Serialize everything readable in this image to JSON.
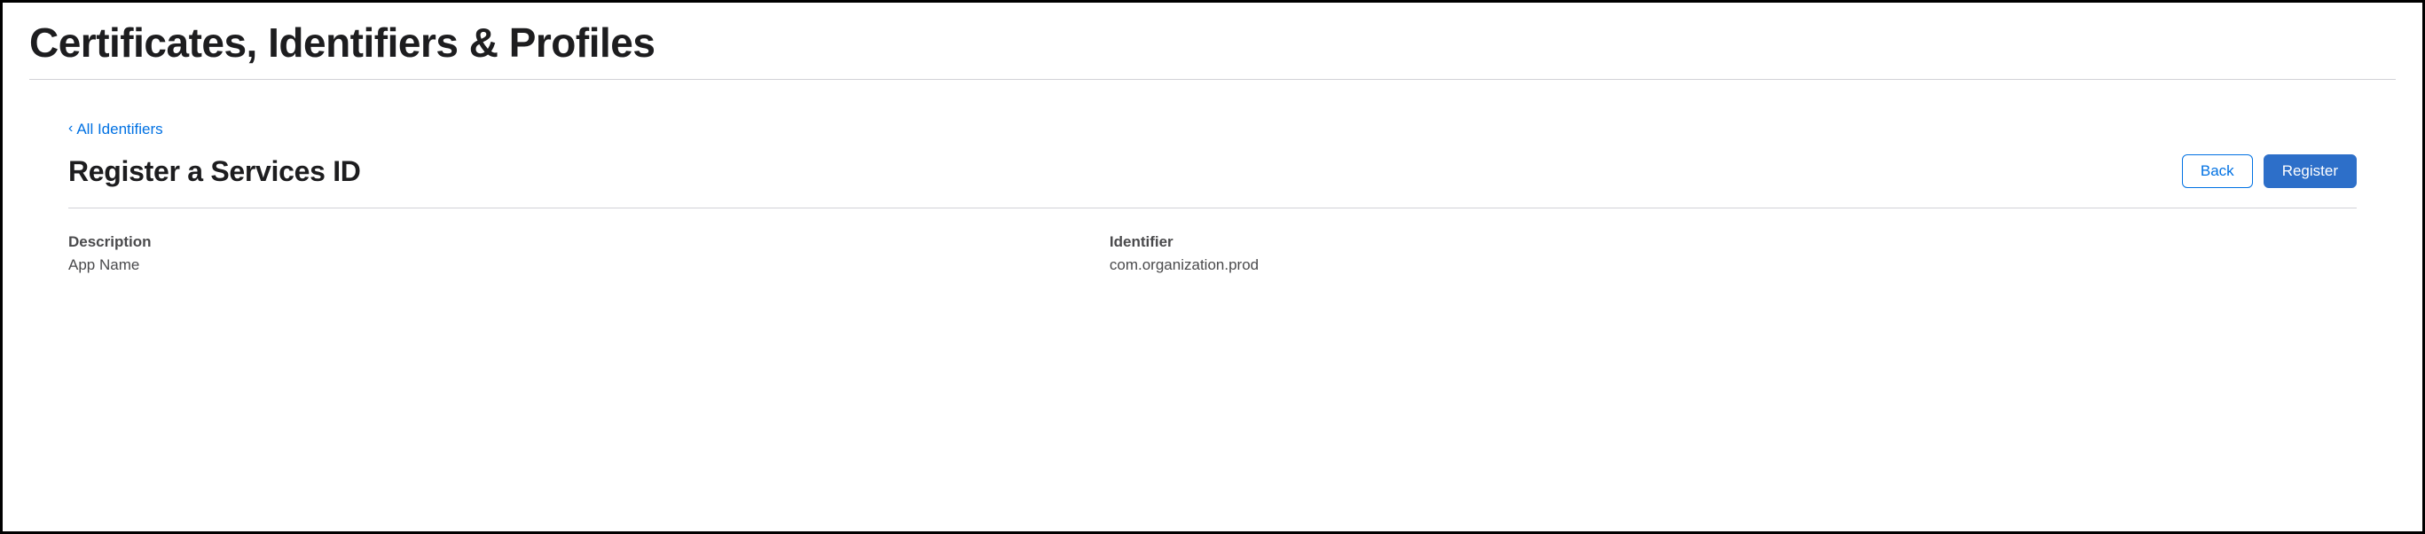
{
  "header": {
    "title": "Certificates, Identifiers & Profiles"
  },
  "nav": {
    "back_label": "All Identifiers"
  },
  "section": {
    "title": "Register a Services ID",
    "back_button": "Back",
    "register_button": "Register"
  },
  "details": {
    "description_label": "Description",
    "description_value": "App Name",
    "identifier_label": "Identifier",
    "identifier_value": "com.organization.prod"
  }
}
